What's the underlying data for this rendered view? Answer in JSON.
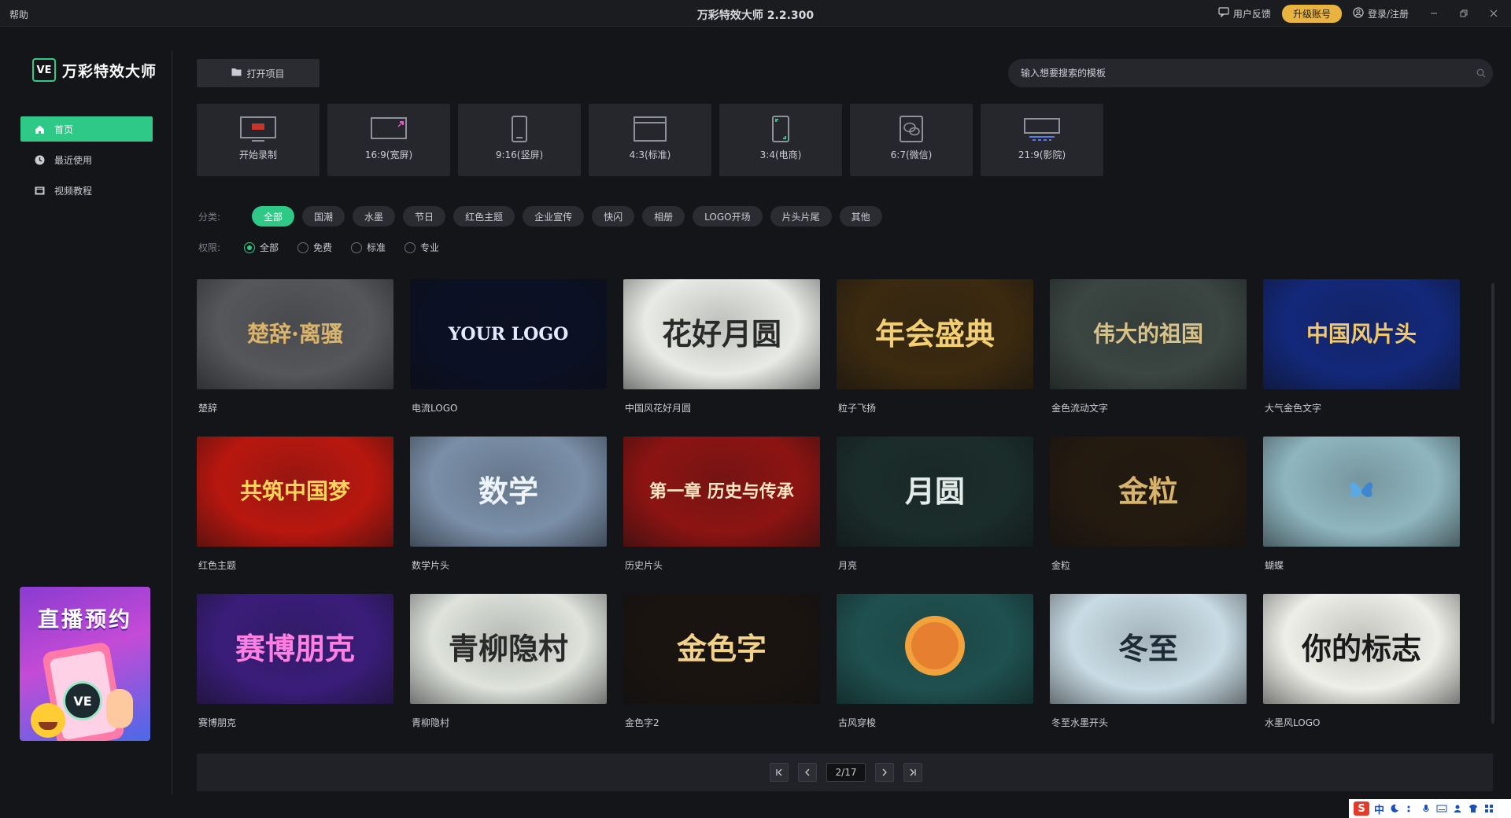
{
  "titlebar": {
    "help": "帮助",
    "title": "万彩特效大师 2.2.300",
    "feedback": "用户反馈",
    "upgrade": "升级账号",
    "login": "登录/注册"
  },
  "sidebar": {
    "logo_mark": "VE",
    "logo_text": "万彩特效大师",
    "items": [
      {
        "label": "首页",
        "icon": "home-icon",
        "active": true
      },
      {
        "label": "最近使用",
        "icon": "clock-icon",
        "active": false
      },
      {
        "label": "视频教程",
        "icon": "video-icon",
        "active": false
      }
    ],
    "promo": {
      "title": "直播预约",
      "badge": "VE"
    }
  },
  "toolbar": {
    "open_project": "打开项目",
    "search_placeholder": "输入想要搜索的模板"
  },
  "ratios": [
    {
      "label": "开始录制",
      "icon": "rec-icon"
    },
    {
      "label": "16:9(宽屏)",
      "icon": "widescreen-icon"
    },
    {
      "label": "9:16(竖屏)",
      "icon": "portrait-icon"
    },
    {
      "label": "4:3(标准)",
      "icon": "standard-icon"
    },
    {
      "label": "3:4(电商)",
      "icon": "ecommerce-icon"
    },
    {
      "label": "6:7(微信)",
      "icon": "wechat-icon"
    },
    {
      "label": "21:9(影院)",
      "icon": "cinema-icon"
    }
  ],
  "filters": {
    "category_label": "分类:",
    "categories": [
      "全部",
      "国潮",
      "水墨",
      "节日",
      "红色主题",
      "企业宣传",
      "快闪",
      "相册",
      "LOGO开场",
      "片头片尾",
      "其他"
    ],
    "active_category": "全部",
    "permission_label": "权限:",
    "permissions": [
      "全部",
      "免费",
      "标准",
      "专业"
    ],
    "active_permission": "全部"
  },
  "templates": [
    {
      "label": "楚辞",
      "thumb_text": "楚辞·离骚",
      "bg": "#55575a",
      "fg": "#d9b46a"
    },
    {
      "label": "电流LOGO",
      "thumb_text": "YOUR LOGO",
      "bg": "#0b1024",
      "fg": "#e6ecff"
    },
    {
      "label": "中国风花好月圆",
      "thumb_text": "花好月圆",
      "bg": "#e9ebe6",
      "fg": "#2a2a2a"
    },
    {
      "label": "粒子飞扬",
      "thumb_text": "年会盛典",
      "bg": "#3b2a10",
      "fg": "#f2cf73"
    },
    {
      "label": "金色流动文字",
      "thumb_text": "伟大的祖国",
      "bg": "#3b4642",
      "fg": "#d9c28a"
    },
    {
      "label": "大气金色文字",
      "thumb_text": "中国风片头",
      "bg": "#13287a",
      "fg": "#f1c96a"
    },
    {
      "label": "红色主题",
      "thumb_text": "共筑中国梦",
      "bg": "#b8170f",
      "fg": "#ffd45a"
    },
    {
      "label": "数学片头",
      "thumb_text": "数学",
      "bg": "#7a8fa8",
      "fg": "#eef3fa"
    },
    {
      "label": "历史片头",
      "thumb_text": "第一章 历史与传承",
      "bg": "#8c1412",
      "fg": "#ffe6c4"
    },
    {
      "label": "月亮",
      "thumb_text": "月圆",
      "bg": "#1b2d2b",
      "fg": "#e3ece9"
    },
    {
      "label": "金粒",
      "thumb_text": "金粒",
      "bg": "#241a10",
      "fg": "#d8b36a"
    },
    {
      "label": "蝴蝶",
      "thumb_text": "",
      "bg": "#8fb6bf",
      "fg": "#ffffff"
    },
    {
      "label": "赛博朋克",
      "thumb_text": "赛博朋克",
      "bg": "#3a1d7a",
      "fg": "#ff7fe3"
    },
    {
      "label": "青柳隐村",
      "thumb_text": "青柳隐村",
      "bg": "#dfe3dc",
      "fg": "#2a2a2a"
    },
    {
      "label": "金色字2",
      "thumb_text": "金色字",
      "bg": "#1a1410",
      "fg": "#f2d28a"
    },
    {
      "label": "古风穿梭",
      "thumb_text": "",
      "bg": "#1f5150",
      "fg": "#f2a23a"
    },
    {
      "label": "冬至水墨开头",
      "thumb_text": "冬至",
      "bg": "#c9dbe4",
      "fg": "#1f2b36"
    },
    {
      "label": "水墨风LOGO",
      "thumb_text": "你的标志",
      "bg": "#efefe9",
      "fg": "#1a1a1a"
    }
  ],
  "pager": {
    "current": "2/17"
  },
  "ime": {
    "zh": "中"
  }
}
